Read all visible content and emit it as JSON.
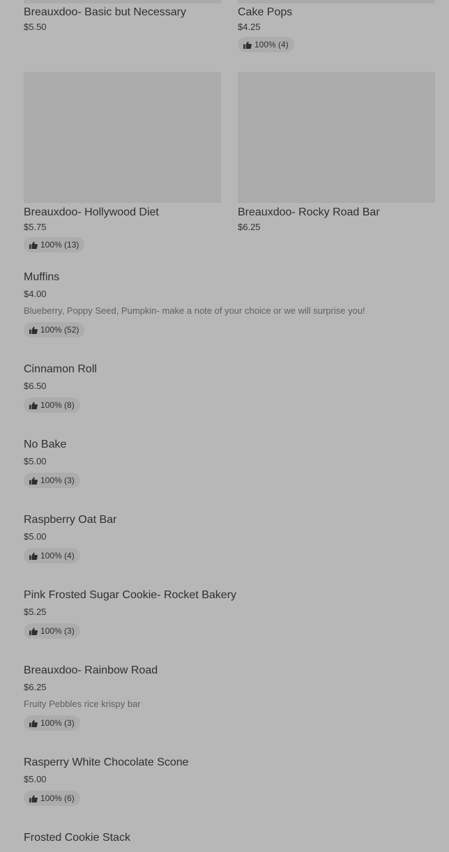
{
  "grid_items": [
    {
      "name": "Breauxdoo- Basic but Necessary",
      "price": "$5.50",
      "rating": ""
    },
    {
      "name": "Cake Pops",
      "price": "$4.25",
      "rating": "100% (4)"
    },
    {
      "name": "Breauxdoo- Hollywood Diet",
      "price": "$5.75",
      "rating": "100% (13)"
    },
    {
      "name": "Breauxdoo- Rocky Road Bar",
      "price": "$6.25",
      "rating": ""
    }
  ],
  "list_items": [
    {
      "name": "Muffins",
      "price": "$4.00",
      "description": "Blueberry, Poppy Seed, Pumpkin- make a note of your choice or we will surprise you!",
      "rating": "100% (52)"
    },
    {
      "name": "Cinnamon Roll",
      "price": "$6.50",
      "description": "",
      "rating": "100% (8)"
    },
    {
      "name": "No Bake",
      "price": "$5.00",
      "description": "",
      "rating": "100% (3)"
    },
    {
      "name": "Raspberry Oat Bar",
      "price": "$5.00",
      "description": "",
      "rating": "100% (4)"
    },
    {
      "name": "Pink Frosted Sugar Cookie- Rocket Bakery",
      "price": "$5.25",
      "description": "",
      "rating": "100% (3)"
    },
    {
      "name": "Breauxdoo- Rainbow Road",
      "price": "$6.25",
      "description": "Fruity Pebbles rice krispy bar",
      "rating": "100% (3)"
    },
    {
      "name": "Rasperry White Chocolate Scone",
      "price": "$5.00",
      "description": "",
      "rating": "100% (6)"
    },
    {
      "name": "Frosted Cookie Stack",
      "price": "",
      "description": "",
      "rating": ""
    }
  ],
  "icons": {
    "rating_icon": "thumbs-up-icon"
  }
}
